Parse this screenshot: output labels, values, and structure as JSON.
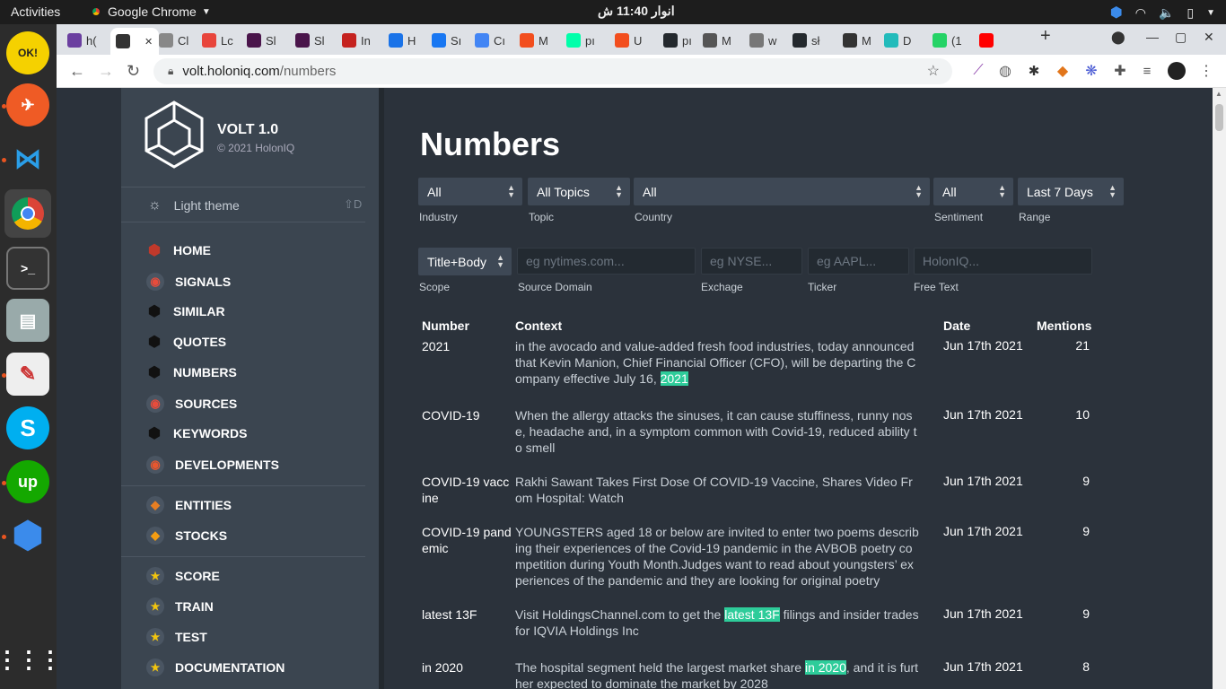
{
  "system": {
    "activities": "Activities",
    "app_name": "Google Chrome",
    "clock": "انوار 11:40 ش"
  },
  "browser": {
    "tabs": [
      {
        "label": "h(",
        "color": "#6b3fa0"
      },
      {
        "label": "",
        "color": "#333",
        "active": true
      },
      {
        "label": "Cl",
        "color": "#888"
      },
      {
        "label": "Lc",
        "color": "#e8453c"
      },
      {
        "label": "Sl",
        "color": "#4a154b"
      },
      {
        "label": "Sl",
        "color": "#4a154b"
      },
      {
        "label": "In",
        "color": "#c5221f"
      },
      {
        "label": "H",
        "color": "#1a73e8"
      },
      {
        "label": "Sı",
        "color": "#1877f2"
      },
      {
        "label": "Cı",
        "color": "#4285f4"
      },
      {
        "label": "M",
        "color": "#f24e1e"
      },
      {
        "label": "pı",
        "color": "#0fa"
      },
      {
        "label": "U",
        "color": "#f24e1e"
      },
      {
        "label": "pı",
        "color": "#24292e"
      },
      {
        "label": "M",
        "color": "#555"
      },
      {
        "label": "w",
        "color": "#777"
      },
      {
        "label": "sł",
        "color": "#24292e"
      },
      {
        "label": "M",
        "color": "#333"
      },
      {
        "label": "D",
        "color": "#2bb"
      },
      {
        "label": "(1",
        "color": "#25d366"
      },
      {
        "label": "",
        "color": "#ff0000"
      }
    ],
    "url_host": "volt.holoniq.com",
    "url_path": "/numbers"
  },
  "sidebar": {
    "brand": "VOLT 1.0",
    "copyright": "© 2021 HolonIQ",
    "theme_label": "Light theme",
    "theme_shortcut": "⇧D",
    "nav": [
      {
        "label": "HOME",
        "icon": "red-hex-icon",
        "color": "#c0392b"
      },
      {
        "label": "SIGNALS",
        "icon": "signal-dot-icon",
        "color": "#e74c3c"
      },
      {
        "label": "SIMILAR",
        "icon": "black-hex-icon",
        "color": "#111"
      },
      {
        "label": "QUOTES",
        "icon": "black-hex-icon",
        "color": "#111"
      },
      {
        "label": "NUMBERS",
        "icon": "black-hex-icon",
        "color": "#111"
      },
      {
        "label": "SOURCES",
        "icon": "signal-dot-icon",
        "color": "#e74c3c"
      },
      {
        "label": "KEYWORDS",
        "icon": "black-hex-icon",
        "color": "#111"
      },
      {
        "label": "DEVELOPMENTS",
        "icon": "signal-dot-icon",
        "color": "#e8572f"
      },
      {
        "label": "ENTITIES",
        "icon": "gem-icon",
        "color": "#e67e22"
      },
      {
        "label": "STOCKS",
        "icon": "gem-icon",
        "color": "#f39c12"
      },
      {
        "label": "SCORE",
        "icon": "star-icon",
        "color": "#f1c40f"
      },
      {
        "label": "TRAIN",
        "icon": "star-icon",
        "color": "#f1c40f"
      },
      {
        "label": "TEST",
        "icon": "star-icon",
        "color": "#f1c40f"
      },
      {
        "label": "DOCUMENTATION",
        "icon": "star-icon",
        "color": "#f1c40f"
      }
    ]
  },
  "page": {
    "title": "Numbers",
    "filters": {
      "industry": {
        "value": "All",
        "label": "Industry"
      },
      "topic": {
        "value": "All Topics",
        "label": "Topic"
      },
      "country": {
        "value": "All",
        "label": "Country"
      },
      "sentiment": {
        "value": "All",
        "label": "Sentiment"
      },
      "range": {
        "value": "Last 7 Days",
        "label": "Range"
      },
      "scope": {
        "value": "Title+Body",
        "label": "Scope"
      }
    },
    "inputs": {
      "source_domain": {
        "placeholder": "eg nytimes.com...",
        "label": "Source Domain"
      },
      "exchange": {
        "placeholder": "eg NYSE...",
        "label": "Exchage"
      },
      "ticker": {
        "placeholder": "eg AAPL...",
        "label": "Ticker"
      },
      "free_text": {
        "placeholder": "HolonIQ...",
        "label": "Free Text"
      }
    },
    "table": {
      "headers": {
        "number": "Number",
        "context": "Context",
        "date": "Date",
        "mentions": "Mentions"
      },
      "rows": [
        {
          "number": "2021",
          "context_pre": "in the avocado and value-added fresh food industries, today announced that Kevin Manion, Chief Financial Officer (CFO), will be departing the Company effective July 16, ",
          "highlight": "2021",
          "context_post": "",
          "date": "Jun 17th 2021",
          "mentions": "21"
        },
        {
          "number": "COVID-19",
          "context_pre": "When the allergy attacks the sinuses, it can cause stuffiness, runny nose, headache and, in a symptom common with Covid-19, reduced ability to smell",
          "highlight": "",
          "context_post": "",
          "date": "Jun 17th 2021",
          "mentions": "10"
        },
        {
          "number": "COVID-19 vaccine",
          "context_pre": "Rakhi Sawant Takes First Dose Of COVID-19 Vaccine, Shares Video From Hospital: Watch",
          "highlight": "",
          "context_post": "",
          "date": "Jun 17th 2021",
          "mentions": "9"
        },
        {
          "number": "COVID-19 pandemic",
          "context_pre": "YOUNGSTERS aged 18 or below are invited to enter two poems describing their experiences of the Covid-19 pandemic in the AVBOB poetry competition during Youth Month.Judges want to read about youngsters’ experiences of the pandemic and they are looking for original poetry",
          "highlight": "",
          "context_post": "",
          "date": "Jun 17th 2021",
          "mentions": "9"
        },
        {
          "number": "latest 13F",
          "context_pre": "Visit HoldingsChannel.com to get the ",
          "highlight": "latest 13F",
          "context_post": " filings and insider trades for IQVIA Holdings Inc",
          "date": "Jun 17th 2021",
          "mentions": "9"
        },
        {
          "number": "in 2020",
          "context_pre": "The hospital segment held the largest market share ",
          "highlight": "in 2020",
          "context_post": ", and it is further expected to dominate the market by 2028",
          "date": "Jun 17th 2021",
          "mentions": "8"
        }
      ]
    }
  }
}
